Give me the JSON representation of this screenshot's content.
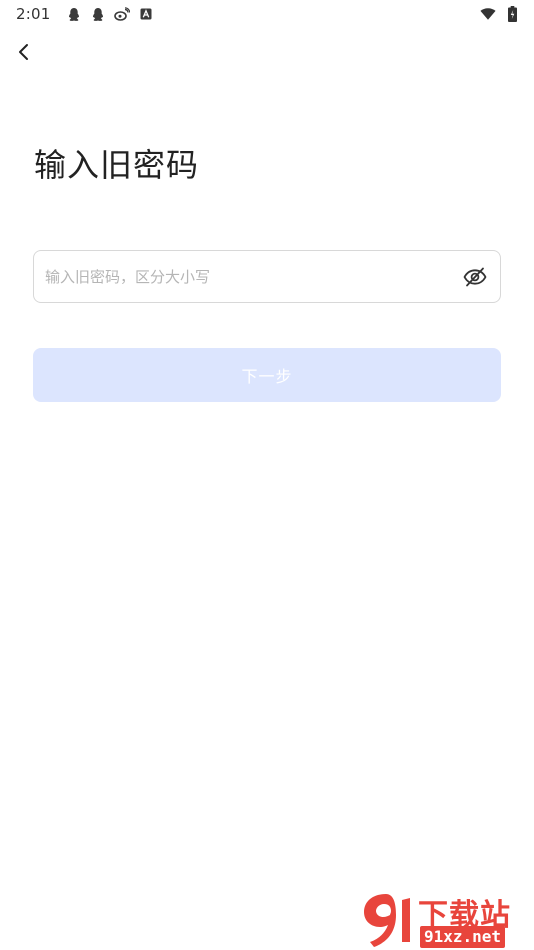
{
  "status_bar": {
    "time": "2:01",
    "icons": [
      "qq-icon",
      "qq-icon",
      "weibo-icon",
      "a-app-icon"
    ],
    "right_icons": [
      "wifi-icon",
      "battery-icon"
    ]
  },
  "page": {
    "title": "输入旧密码"
  },
  "password_field": {
    "value": "",
    "placeholder": "输入旧密码，区分大小写",
    "toggle_icon": "eye-off-icon"
  },
  "next_button": {
    "label": "下一步",
    "state": "disabled",
    "color": "#dce5fe"
  },
  "watermark": {
    "brand": "下载站",
    "url": "91xz.net",
    "color": "#e8453c"
  }
}
